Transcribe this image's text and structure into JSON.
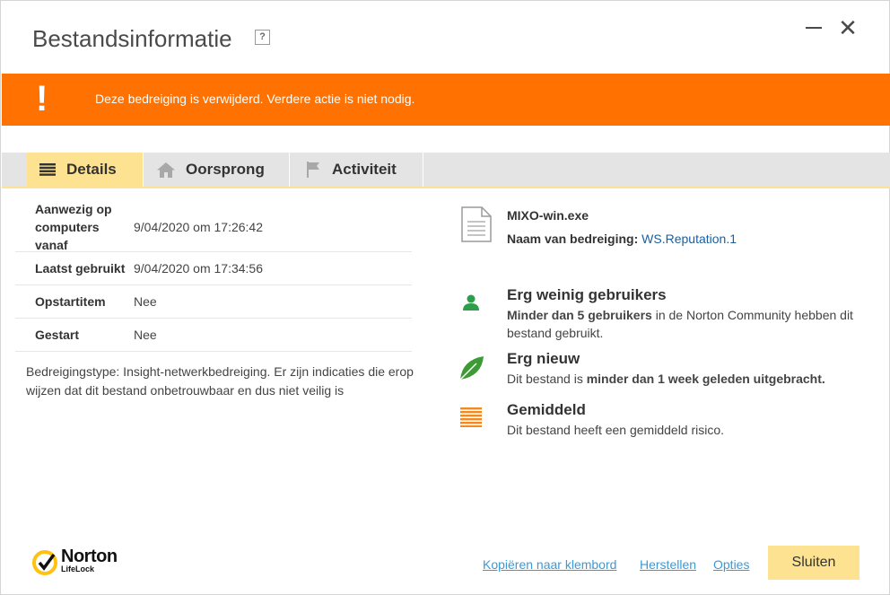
{
  "window": {
    "title": "Bestandsinformatie",
    "help_label": "?",
    "close_glyph": "✕"
  },
  "banner": {
    "icon_glyph": "!",
    "message": "Deze bedreiging is verwijderd. Verdere actie is niet nodig.",
    "color": "#ff7101"
  },
  "tabs": [
    {
      "label": "Details",
      "icon": "list-icon",
      "active": true
    },
    {
      "label": "Oorsprong",
      "icon": "home-icon",
      "active": false
    },
    {
      "label": "Activiteit",
      "icon": "flag-icon",
      "active": false
    }
  ],
  "properties": [
    {
      "label": "Aanwezig op computers vanaf",
      "value": "9/04/2020 om 17:26:42"
    },
    {
      "label": "Laatst gebruikt",
      "value": "9/04/2020 om 17:34:56"
    },
    {
      "label": "Opstartitem",
      "value": "Nee"
    },
    {
      "label": "Gestart",
      "value": "Nee"
    }
  ],
  "description": "Bedreigingstype: Insight-netwerkbedreiging. Er zijn indicaties die erop wijzen dat dit bestand onbetrouwbaar en dus niet veilig is",
  "file": {
    "name": "MIXO-win.exe",
    "threat_label": "Naam van bedreiging:",
    "threat_name": "WS.Reputation.1"
  },
  "info_blocks": [
    {
      "icon": "user-icon",
      "title": "Erg weinig gebruikers",
      "bold_part": "Minder dan 5 gebruikers",
      "rest": " in de Norton Community hebben dit bestand gebruikt."
    },
    {
      "icon": "leaf-icon",
      "title": "Erg nieuw",
      "prefix": "Dit bestand is ",
      "bold_part": "minder dan 1 week geleden uitgebracht."
    },
    {
      "icon": "risk-bars-icon",
      "title": "Gemiddeld",
      "text": "Dit bestand heeft een gemiddeld risico."
    }
  ],
  "footer": {
    "logo_name": "Norton",
    "logo_sub": "LifeLock",
    "copy_link": "Kopiëren naar klembord",
    "restore_link": "Herstellen",
    "options_link": "Opties",
    "close_button": "Sluiten"
  }
}
